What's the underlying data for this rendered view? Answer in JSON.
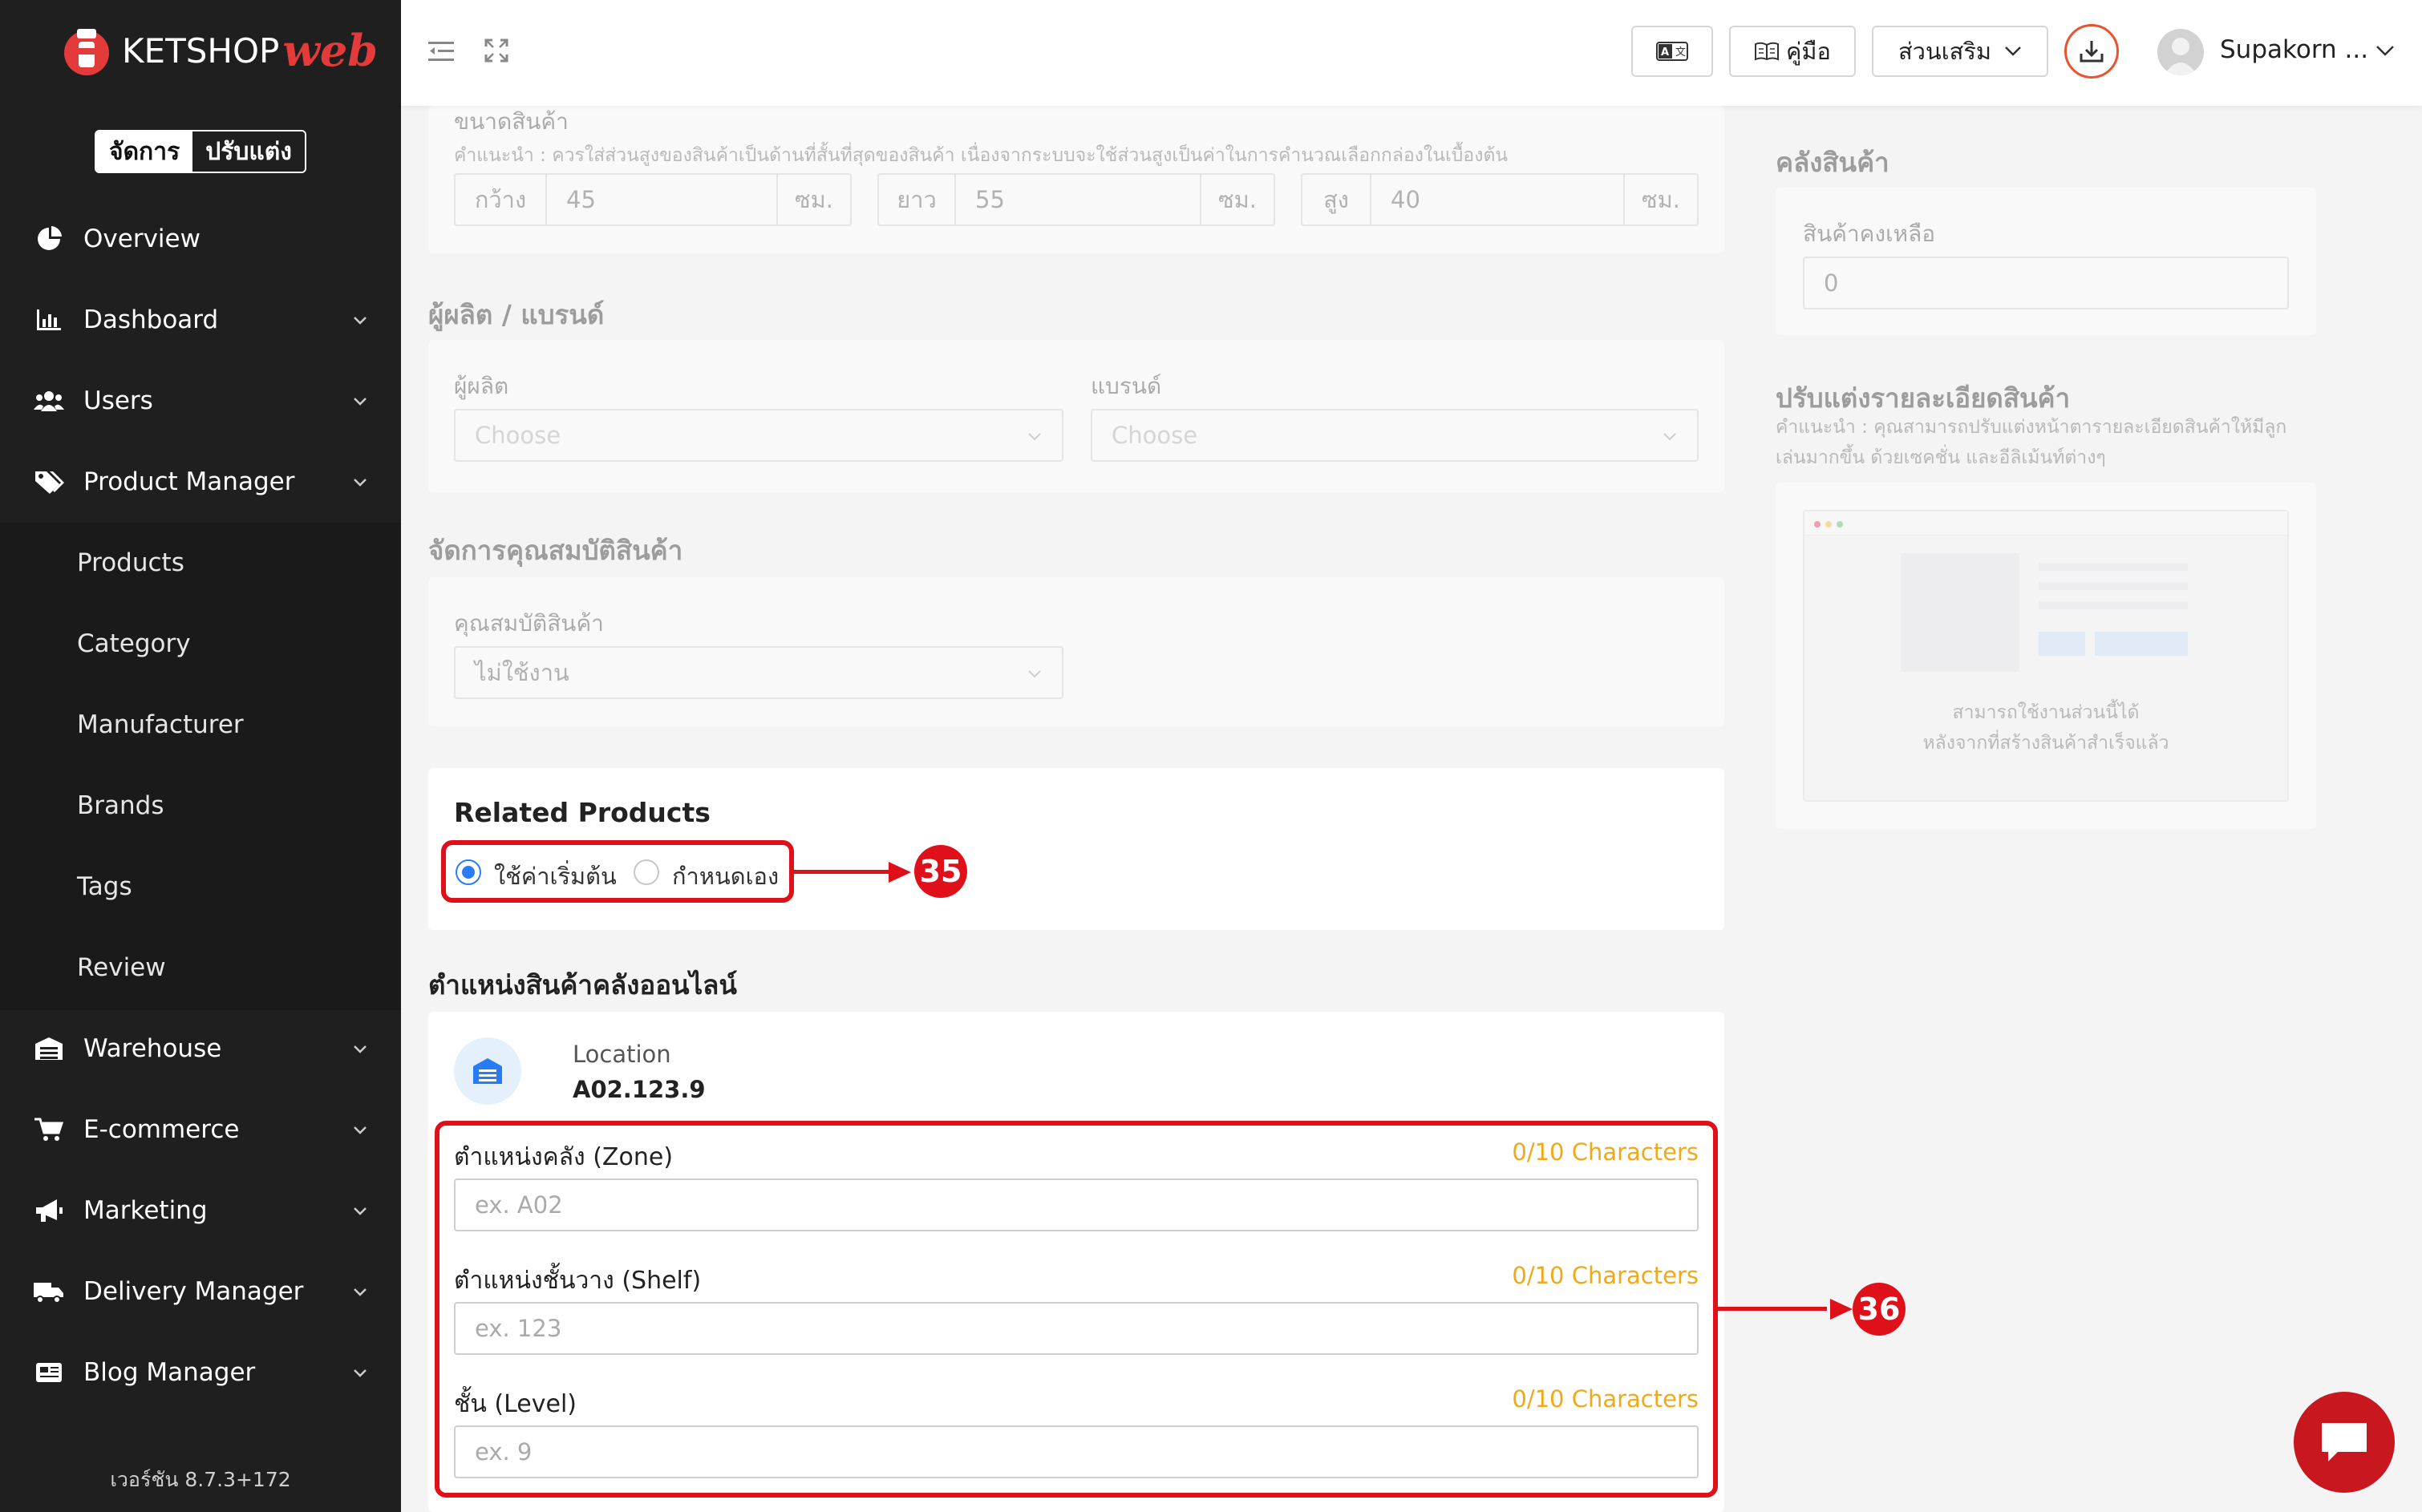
{
  "sidebar": {
    "brand": {
      "name": "KETSHOP",
      "script": "web"
    },
    "mode_toggle": {
      "manage": "จัดการ",
      "customize": "ปรับแต่ง"
    },
    "items": [
      {
        "label": "Overview",
        "icon": "pie-chart-icon"
      },
      {
        "label": "Dashboard",
        "icon": "bar-chart-icon"
      },
      {
        "label": "Users",
        "icon": "users-icon"
      },
      {
        "label": "Product Manager",
        "icon": "tags-icon"
      },
      {
        "label": "Warehouse",
        "icon": "warehouse-icon"
      },
      {
        "label": "E-commerce",
        "icon": "cart-icon"
      },
      {
        "label": "Marketing",
        "icon": "megaphone-icon"
      },
      {
        "label": "Delivery Manager",
        "icon": "truck-icon"
      },
      {
        "label": "Blog Manager",
        "icon": "newspaper-icon"
      }
    ],
    "sub_items": [
      "Products",
      "Category",
      "Manufacturer",
      "Brands",
      "Tags",
      "Review"
    ],
    "version": "เวอร์ชัน 8.7.3+172"
  },
  "header": {
    "manual_label": "คู่มือ",
    "addons_label": "ส่วนเสริม",
    "user_name": "Supakorn ..."
  },
  "size": {
    "title": "ขนาดสินค้า",
    "hint": "คำแนะนำ : ควรใส่ส่วนสูงของสินค้าเป็นด้านที่สั้นที่สุดของสินค้า เนื่องจากระบบจะใช้ส่วนสูงเป็นค่าในการคำนวณเลือกกล่องในเบื้องต้น",
    "width": {
      "label": "กว้าง",
      "value": "45",
      "unit": "ซม."
    },
    "length": {
      "label": "ยาว",
      "value": "55",
      "unit": "ซม."
    },
    "height": {
      "label": "สูง",
      "value": "40",
      "unit": "ซม."
    }
  },
  "brand_section": {
    "title": "ผู้ผลิต / แบรนด์",
    "manufacturer_label": "ผู้ผลิต",
    "manufacturer_placeholder": "Choose",
    "brand_label": "แบรนด์",
    "brand_placeholder": "Choose"
  },
  "attributes": {
    "title": "จัดการคุณสมบัติสินค้า",
    "label": "คุณสมบัติสินค้า",
    "value": "ไม่ใช้งาน"
  },
  "related": {
    "title": "Related Products",
    "option_default": "ใช้ค่าเริ่มต้น",
    "option_custom": "กำหนดเอง",
    "selected": "option_default"
  },
  "location_section": {
    "title": "ตำแหน่งสินค้าคลังออนไลน์",
    "location_label": "Location",
    "location_value": "A02.123.9",
    "zone": {
      "label": "ตำแหน่งคลัง (Zone)",
      "count": "0/10 Characters",
      "placeholder": "ex. A02"
    },
    "shelf": {
      "label": "ตำแหน่งชั้นวาง (Shelf)",
      "count": "0/10 Characters",
      "placeholder": "ex. 123"
    },
    "level": {
      "label": "ชั้น (Level)",
      "count": "0/10 Characters",
      "placeholder": "ex. 9"
    }
  },
  "stock": {
    "title": "คลังสินค้า",
    "remaining_label": "สินค้าคงเหลือ",
    "remaining_value": "0"
  },
  "customize": {
    "title": "ปรับแต่งรายละเอียดสินค้า",
    "hint": "คำแนะนำ : คุณสามารถปรับแต่งหน้าตารายละเอียดสินค้าให้มีลูกเล่นมากขึ้น ด้วยเซคชั่น และอีลิเม้นท์ต่างๆ",
    "note_line1": "สามารถใช้งานส่วนนี้ได้",
    "note_line2": "หลังจากที่สร้างสินค้าสำเร็จแล้ว"
  },
  "annotations": {
    "related": "35",
    "location": "36"
  },
  "colors": {
    "accent": "#2a7bf6",
    "annotation": "#e0101b",
    "counter": "#f1a91c",
    "sidebar": "#1f1f1f"
  }
}
